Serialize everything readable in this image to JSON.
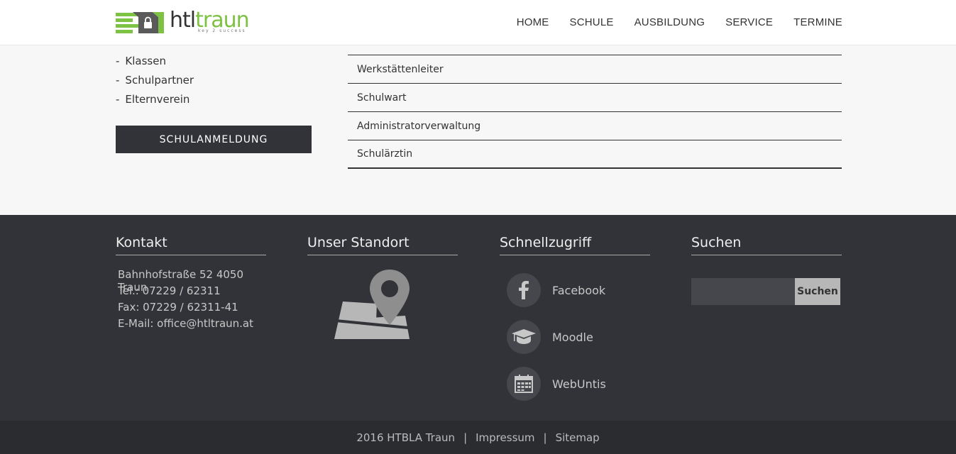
{
  "header": {
    "logo": {
      "word_a": "htl",
      "word_b": "traun",
      "tagline": "key 2 success"
    },
    "nav": [
      "HOME",
      "SCHULE",
      "AUSBILDUNG",
      "SERVICE",
      "TERMINE"
    ]
  },
  "sidebar": {
    "links": [
      "Klassen",
      "Schulpartner",
      "Elternverein"
    ],
    "cta_label": "SCHULANMELDUNG"
  },
  "staff_list": [
    "Werkstättenleiter",
    "Schulwart",
    "Administratorverwaltung",
    "Schulärztin"
  ],
  "footer": {
    "contact": {
      "title": "Kontakt",
      "lines": [
        "Bahnhofstraße 52 4050 Traun",
        "Tel.: 07229 / 62311",
        "Fax: 07229 / 62311-41",
        "E-Mail: office@htltraun.at"
      ]
    },
    "location": {
      "title": "Unser Standort"
    },
    "quick": {
      "title": "Schnellzugriff",
      "items": [
        {
          "label": "Facebook",
          "icon": "facebook-icon"
        },
        {
          "label": "Moodle",
          "icon": "graduation-cap-icon"
        },
        {
          "label": "WebUntis",
          "icon": "calendar-icon"
        }
      ]
    },
    "search": {
      "title": "Suchen",
      "button_label": "Suchen",
      "value": ""
    }
  },
  "bottom": {
    "copyright": "2016 HTBLA Traun",
    "impressum": "Impressum",
    "sitemap": "Sitemap",
    "separator": "|"
  },
  "colors": {
    "accent_green": "#7dc242",
    "footer_bg": "#323338",
    "bottom_bg": "#2b2c30"
  }
}
